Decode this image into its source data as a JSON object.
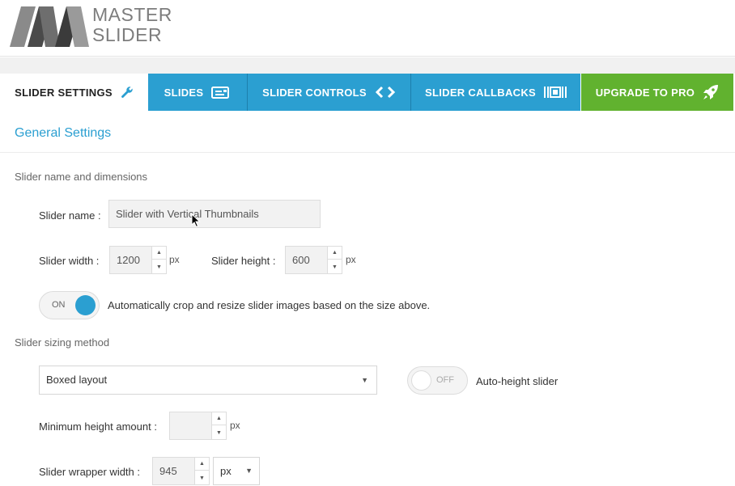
{
  "logo": {
    "line1": "MASTER",
    "line2": "SLIDER"
  },
  "tabs": [
    {
      "label": "SLIDER SETTINGS",
      "icon": "wrench-icon"
    },
    {
      "label": "SLIDES",
      "icon": "slides-icon"
    },
    {
      "label": "SLIDER CONTROLS",
      "icon": "arrows-icon"
    },
    {
      "label": "SLIDER CALLBACKS",
      "icon": "callbacks-icon"
    },
    {
      "label": "UPGRADE TO PRO",
      "icon": "rocket-icon"
    }
  ],
  "section": {
    "title": "General Settings"
  },
  "dimensions": {
    "group_label": "Slider name and dimensions",
    "name_label": "Slider name :",
    "name_value": "Slider with Vertical Thumbnails",
    "width_label": "Slider width :",
    "width_value": "1200",
    "width_unit": "px",
    "height_label": "Slider height :",
    "height_value": "600",
    "height_unit": "px",
    "crop_toggle": "ON",
    "crop_label": "Automatically crop and resize slider images based on the size above."
  },
  "sizing": {
    "group_label": "Slider sizing method",
    "layout_value": "Boxed layout",
    "autoheight_toggle": "OFF",
    "autoheight_label": "Auto-height slider",
    "min_height_label": "Minimum height amount :",
    "min_height_value": "",
    "min_height_unit": "px",
    "wrapper_label": "Slider wrapper width :",
    "wrapper_value": "945",
    "wrapper_unit": "px"
  },
  "colors": {
    "accent": "#2b9fd1",
    "pro": "#61b22f"
  }
}
